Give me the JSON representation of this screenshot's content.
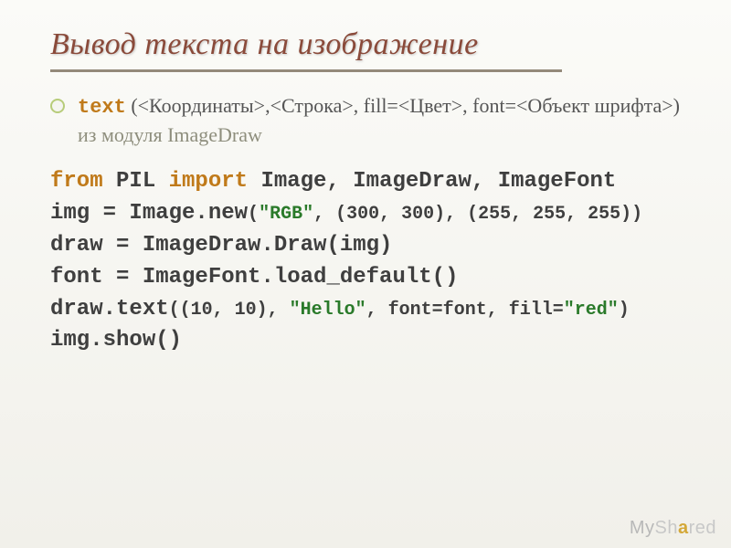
{
  "title": "Вывод текста на изображение",
  "bullet": {
    "fn": "text",
    "args": " (<Координаты>,<Строка>, fill=<Цвет>, font=<Объект шрифта>) ",
    "tail": "из модуля ImageDraw"
  },
  "code": {
    "l1_from": "from",
    "l1_pil": " PIL ",
    "l1_import": "import",
    "l1_rest": " Image, ImageDraw, ImageFont",
    "l2a": "img = Image.new",
    "l2b": "(",
    "l2s1": "\"RGB\"",
    "l2c": ", (300, 300), (255, 255, 255))",
    "l3": "draw = ImageDraw.Draw(img)",
    "l4": "font = ImageFont.load_default()",
    "l5a": "draw.text",
    "l5b": "((10, 10), ",
    "l5s1": "\"Hello\"",
    "l5c": ", font=font, fill=",
    "l5s2": "\"red\"",
    "l5d": ")",
    "l6": "img.show()"
  },
  "watermark": {
    "my": "My",
    "sh": "Sh",
    "a": "a",
    "red": "red"
  }
}
